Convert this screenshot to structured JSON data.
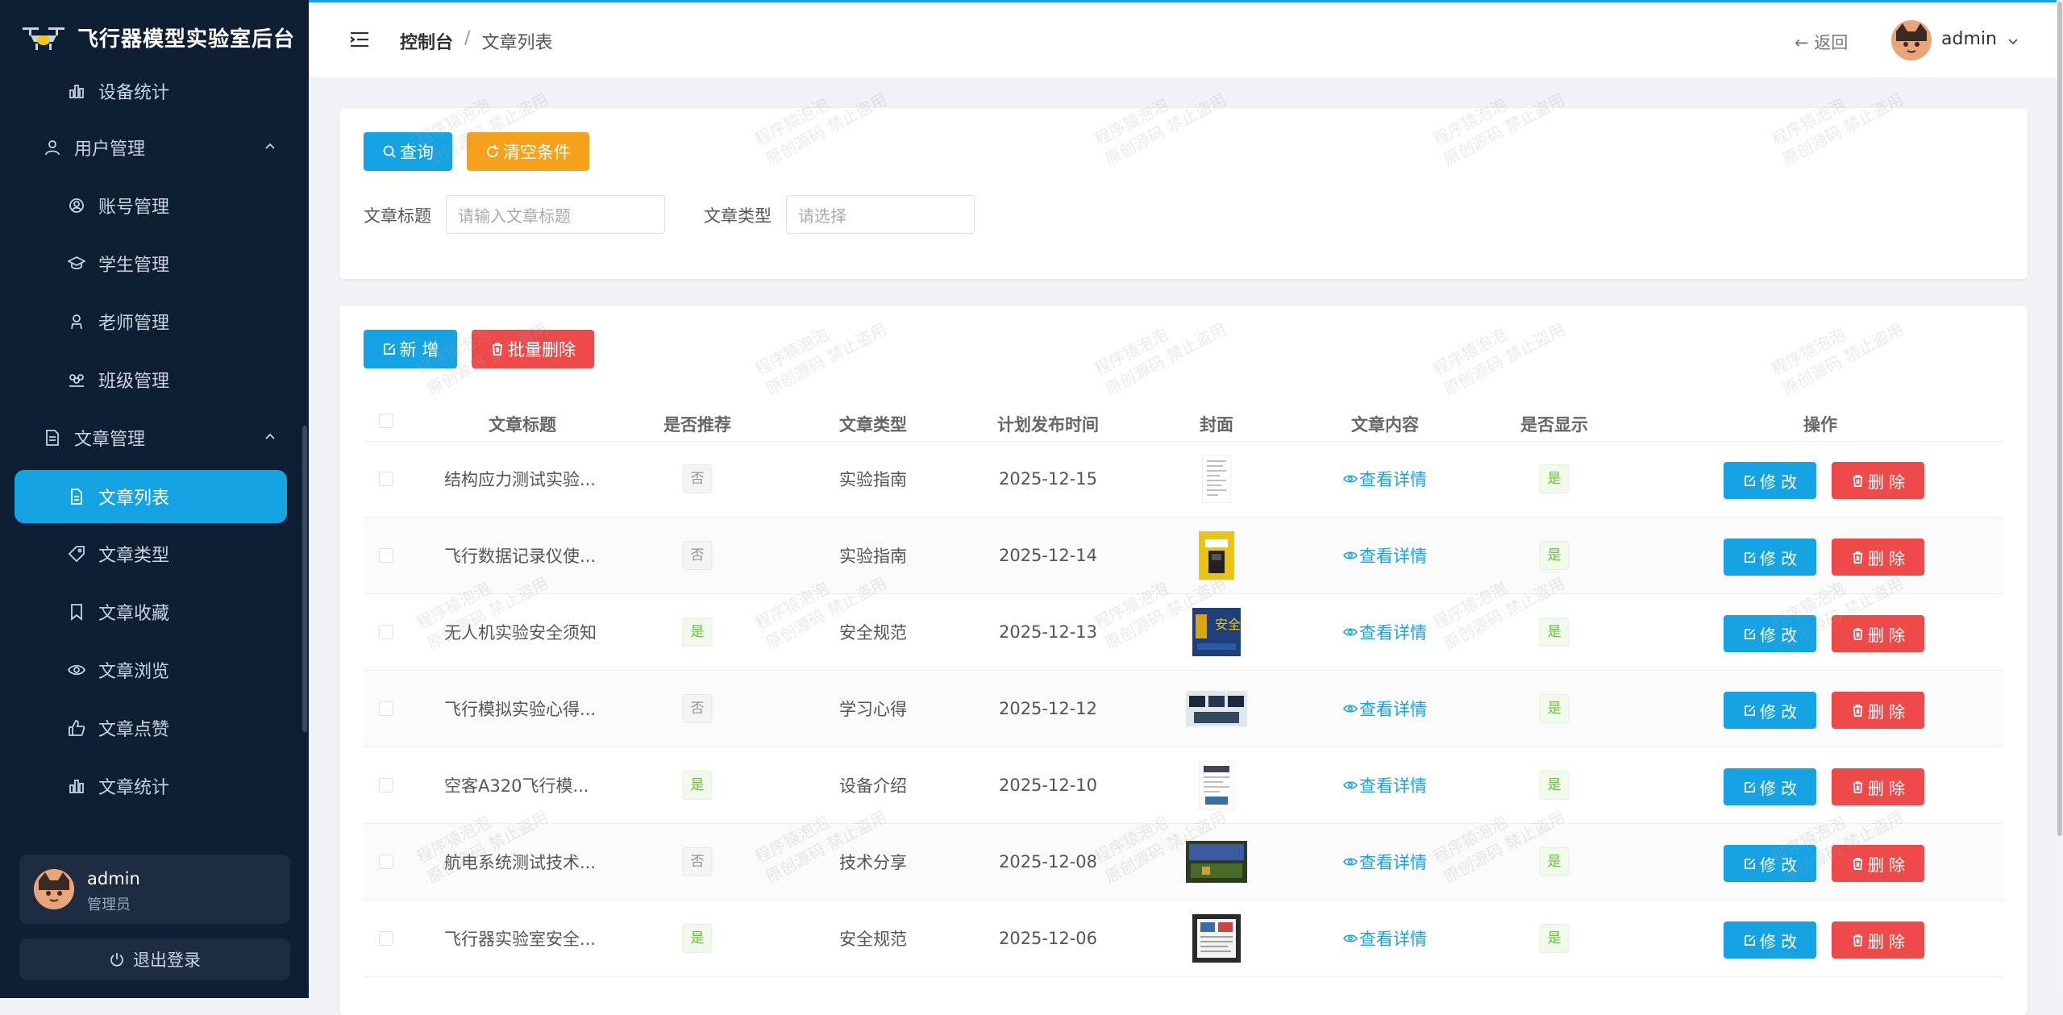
{
  "app": {
    "title": "飞行器模型实验室后台"
  },
  "sidebar": {
    "items": [
      {
        "label": "设备统计",
        "icon": "bar-chart-icon"
      },
      {
        "label": "用户管理",
        "icon": "user-icon",
        "expanded": true
      },
      {
        "label": "账号管理",
        "icon": "account-icon"
      },
      {
        "label": "学生管理",
        "icon": "graduation-cap-icon"
      },
      {
        "label": "老师管理",
        "icon": "teacher-icon"
      },
      {
        "label": "班级管理",
        "icon": "class-icon"
      },
      {
        "label": "文章管理",
        "icon": "document-icon",
        "expanded": true
      },
      {
        "label": "文章列表",
        "icon": "file-icon",
        "active": true
      },
      {
        "label": "文章类型",
        "icon": "tag-icon"
      },
      {
        "label": "文章收藏",
        "icon": "bookmark-icon"
      },
      {
        "label": "文章浏览",
        "icon": "eye-icon"
      },
      {
        "label": "文章点赞",
        "icon": "thumb-up-icon"
      },
      {
        "label": "文章统计",
        "icon": "bar-chart-icon"
      }
    ],
    "user": {
      "name": "admin",
      "role": "管理员"
    },
    "logout_label": "退出登录"
  },
  "header": {
    "breadcrumb": [
      "控制台",
      "/",
      "文章列表"
    ],
    "back_label": "返回",
    "user": "admin"
  },
  "search": {
    "query_label": "查询",
    "clear_label": "清空条件",
    "title_label": "文章标题",
    "title_placeholder": "请输入文章标题",
    "type_label": "文章类型",
    "type_placeholder": "请选择"
  },
  "toolbar": {
    "add_label": "新 增",
    "batch_delete_label": "批量删除"
  },
  "table": {
    "columns": [
      "文章标题",
      "是否推荐",
      "文章类型",
      "计划发布时间",
      "封面",
      "文章内容",
      "是否显示",
      "操作"
    ],
    "view_label": "查看详情",
    "edit_label": "修 改",
    "delete_label": "删 除",
    "rows": [
      {
        "title": "结构应力测试实验...",
        "recommend": "否",
        "type": "实验指南",
        "date": "2025-12-15",
        "display": "是"
      },
      {
        "title": "飞行数据记录仪使...",
        "recommend": "否",
        "type": "实验指南",
        "date": "2025-12-14",
        "display": "是"
      },
      {
        "title": "无人机实验安全须知",
        "recommend": "是",
        "type": "安全规范",
        "date": "2025-12-13",
        "display": "是"
      },
      {
        "title": "飞行模拟实验心得...",
        "recommend": "否",
        "type": "学习心得",
        "date": "2025-12-12",
        "display": "是"
      },
      {
        "title": "空客A320飞行模...",
        "recommend": "是",
        "type": "设备介绍",
        "date": "2025-12-10",
        "display": "是"
      },
      {
        "title": "航电系统测试技术...",
        "recommend": "否",
        "type": "技术分享",
        "date": "2025-12-08",
        "display": "是"
      },
      {
        "title": "飞行器实验室安全...",
        "recommend": "是",
        "type": "安全规范",
        "date": "2025-12-06",
        "display": "是"
      }
    ]
  },
  "watermark": {
    "line1": "程序猿泡泡",
    "line2": "原创源码 禁止盗用"
  },
  "colors": {
    "primary": "#15a3e4",
    "warning": "#f5a11c",
    "danger": "#ef4a4a",
    "sidebar": "#0f1f33"
  }
}
